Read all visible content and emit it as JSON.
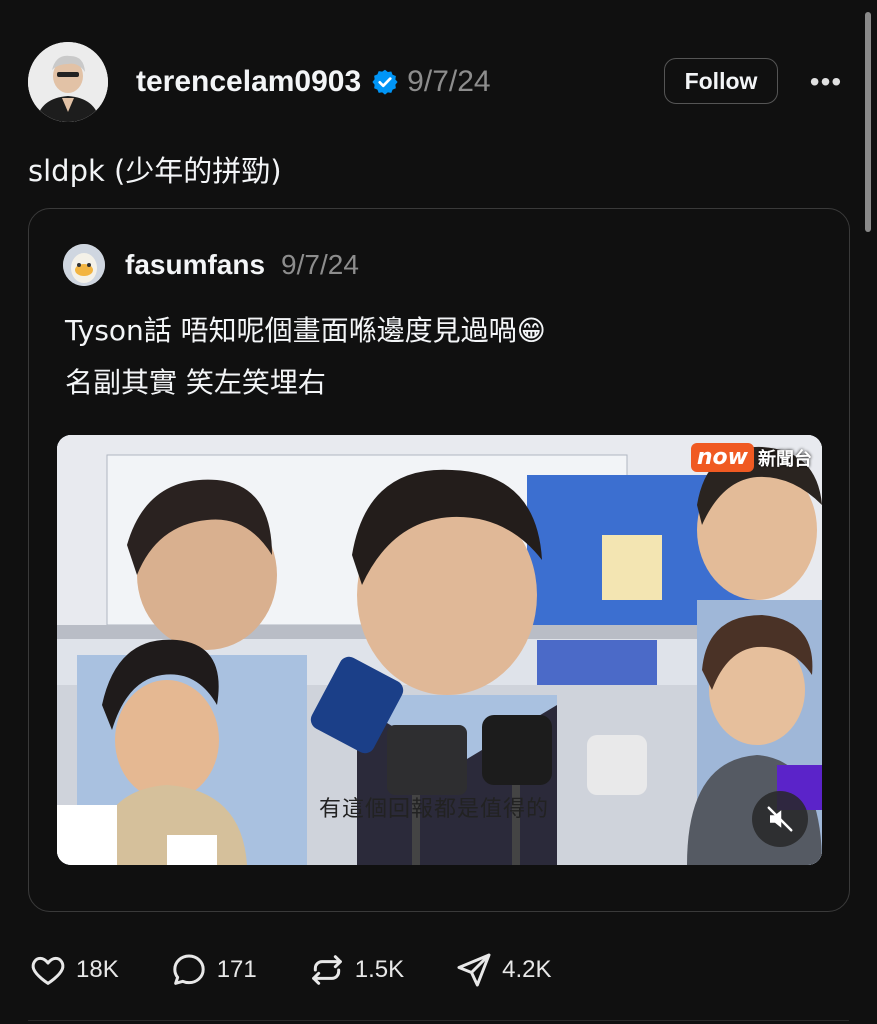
{
  "post": {
    "username": "terencelam0903",
    "date": "9/7/24",
    "follow_label": "Follow",
    "more_label": "•••",
    "caption": "sldpk (少年的拼勁)"
  },
  "quote": {
    "username": "fasumfans",
    "date": "9/7/24",
    "text_line1": "Tyson話 唔知呢個畫面喺邊度見過喎😁",
    "text_line2": "名副其實 笑左笑埋右"
  },
  "video": {
    "subtitle": "有這個回報都是值得的",
    "channel_now": "now",
    "channel_news": "新聞台"
  },
  "actions": {
    "likes": "18K",
    "replies": "171",
    "reposts": "1.5K",
    "shares": "4.2K"
  },
  "colors": {
    "background": "#101010",
    "verified": "#0095f6",
    "muted_text": "#8d8d8d"
  }
}
